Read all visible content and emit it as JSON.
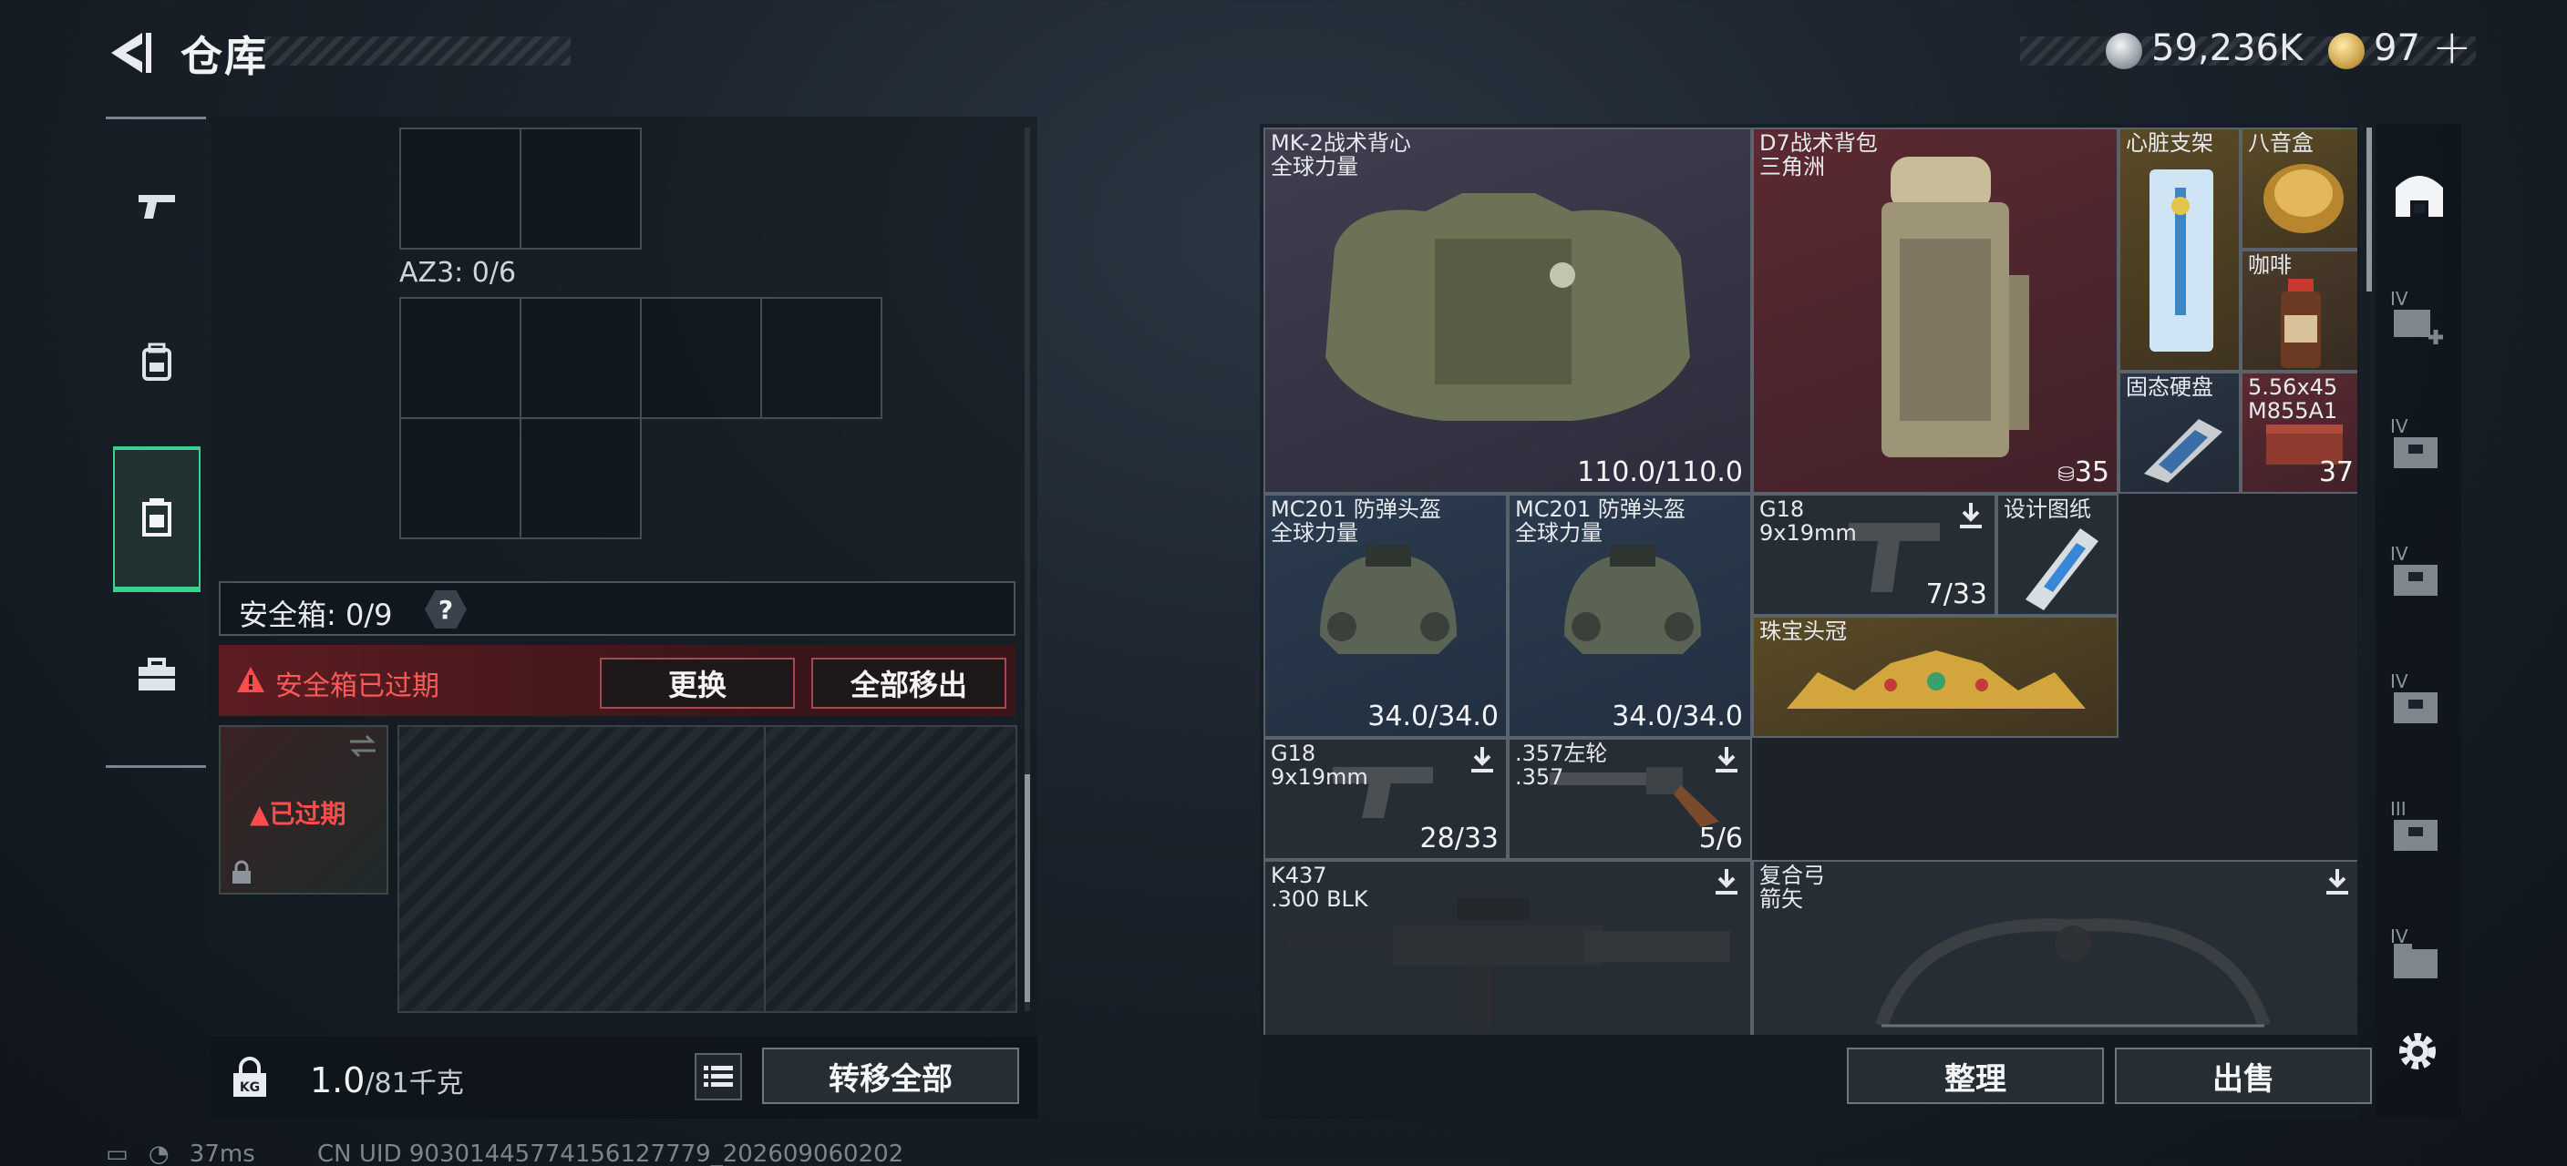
{
  "header": {
    "title": "仓库",
    "currency_silver": "59,236K",
    "currency_gold": "97",
    "add_symbol": "+"
  },
  "left_panel": {
    "az3_label": "AZ3: 0/6",
    "safe_box_label": "安全箱: 0/9",
    "help_symbol": "?",
    "expired_warning": "安全箱已过期",
    "replace_button": "更换",
    "remove_all_button": "全部移出",
    "expired_slot_text": "已过期",
    "weight_value": "1.0",
    "weight_max": "/81千克",
    "transfer_all_button": "转移全部"
  },
  "status": {
    "ping": "37ms",
    "uid": "CN UID 903014457741561277​79_202609060202"
  },
  "inventory": {
    "items": [
      {
        "id": "vest",
        "name": "MK-2战术背心",
        "sub": "全球力量",
        "value": "110.0/110.0"
      },
      {
        "id": "backpack",
        "name": "D7战术背包",
        "sub": "三角洲",
        "value": "35"
      },
      {
        "id": "heart-stand",
        "name": "心脏支架",
        "sub": "",
        "value": ""
      },
      {
        "id": "music-box",
        "name": "八音盒",
        "sub": "",
        "value": ""
      },
      {
        "id": "coffee",
        "name": "咖啡",
        "sub": "",
        "value": ""
      },
      {
        "id": "ssd",
        "name": "固态硬盘",
        "sub": "",
        "value": ""
      },
      {
        "id": "ammo",
        "name": "5.56x45",
        "sub": "M855A1",
        "value": "37"
      },
      {
        "id": "helmet1",
        "name": "MC201 防弹头盔",
        "sub": "全球力量",
        "value": "34.0/34.0"
      },
      {
        "id": "helmet2",
        "name": "MC201 防弹头盔",
        "sub": "全球力量",
        "value": "34.0/34.0"
      },
      {
        "id": "g18a",
        "name": "G18",
        "sub": "9x19mm",
        "value": "7/33"
      },
      {
        "id": "blueprint",
        "name": "设计图纸",
        "sub": "",
        "value": ""
      },
      {
        "id": "crown",
        "name": "珠宝头冠",
        "sub": "",
        "value": ""
      },
      {
        "id": "g18b",
        "name": "G18",
        "sub": "9x19mm",
        "value": "28/33"
      },
      {
        "id": "revolver",
        "name": ".357左轮",
        "sub": ".357",
        "value": "5/6"
      },
      {
        "id": "k437",
        "name": "K437",
        "sub": ".300 BLK",
        "value": ""
      },
      {
        "id": "bow",
        "name": "复合弓",
        "sub": "箭矢",
        "value": ""
      }
    ]
  },
  "actions": {
    "sort_button": "整理",
    "sell_button": "出售"
  },
  "right_rail": {
    "tiers": [
      "IV",
      "IV",
      "IV",
      "IV",
      "III",
      "IV"
    ]
  },
  "colors": {
    "accent_green": "#3ad08d",
    "warning_red": "#ff5a5a",
    "vest_bg": "#3a3846",
    "backpack_bg": "#4a2228",
    "gold_bg": "#4a3c22",
    "blue_bg": "#243244"
  }
}
